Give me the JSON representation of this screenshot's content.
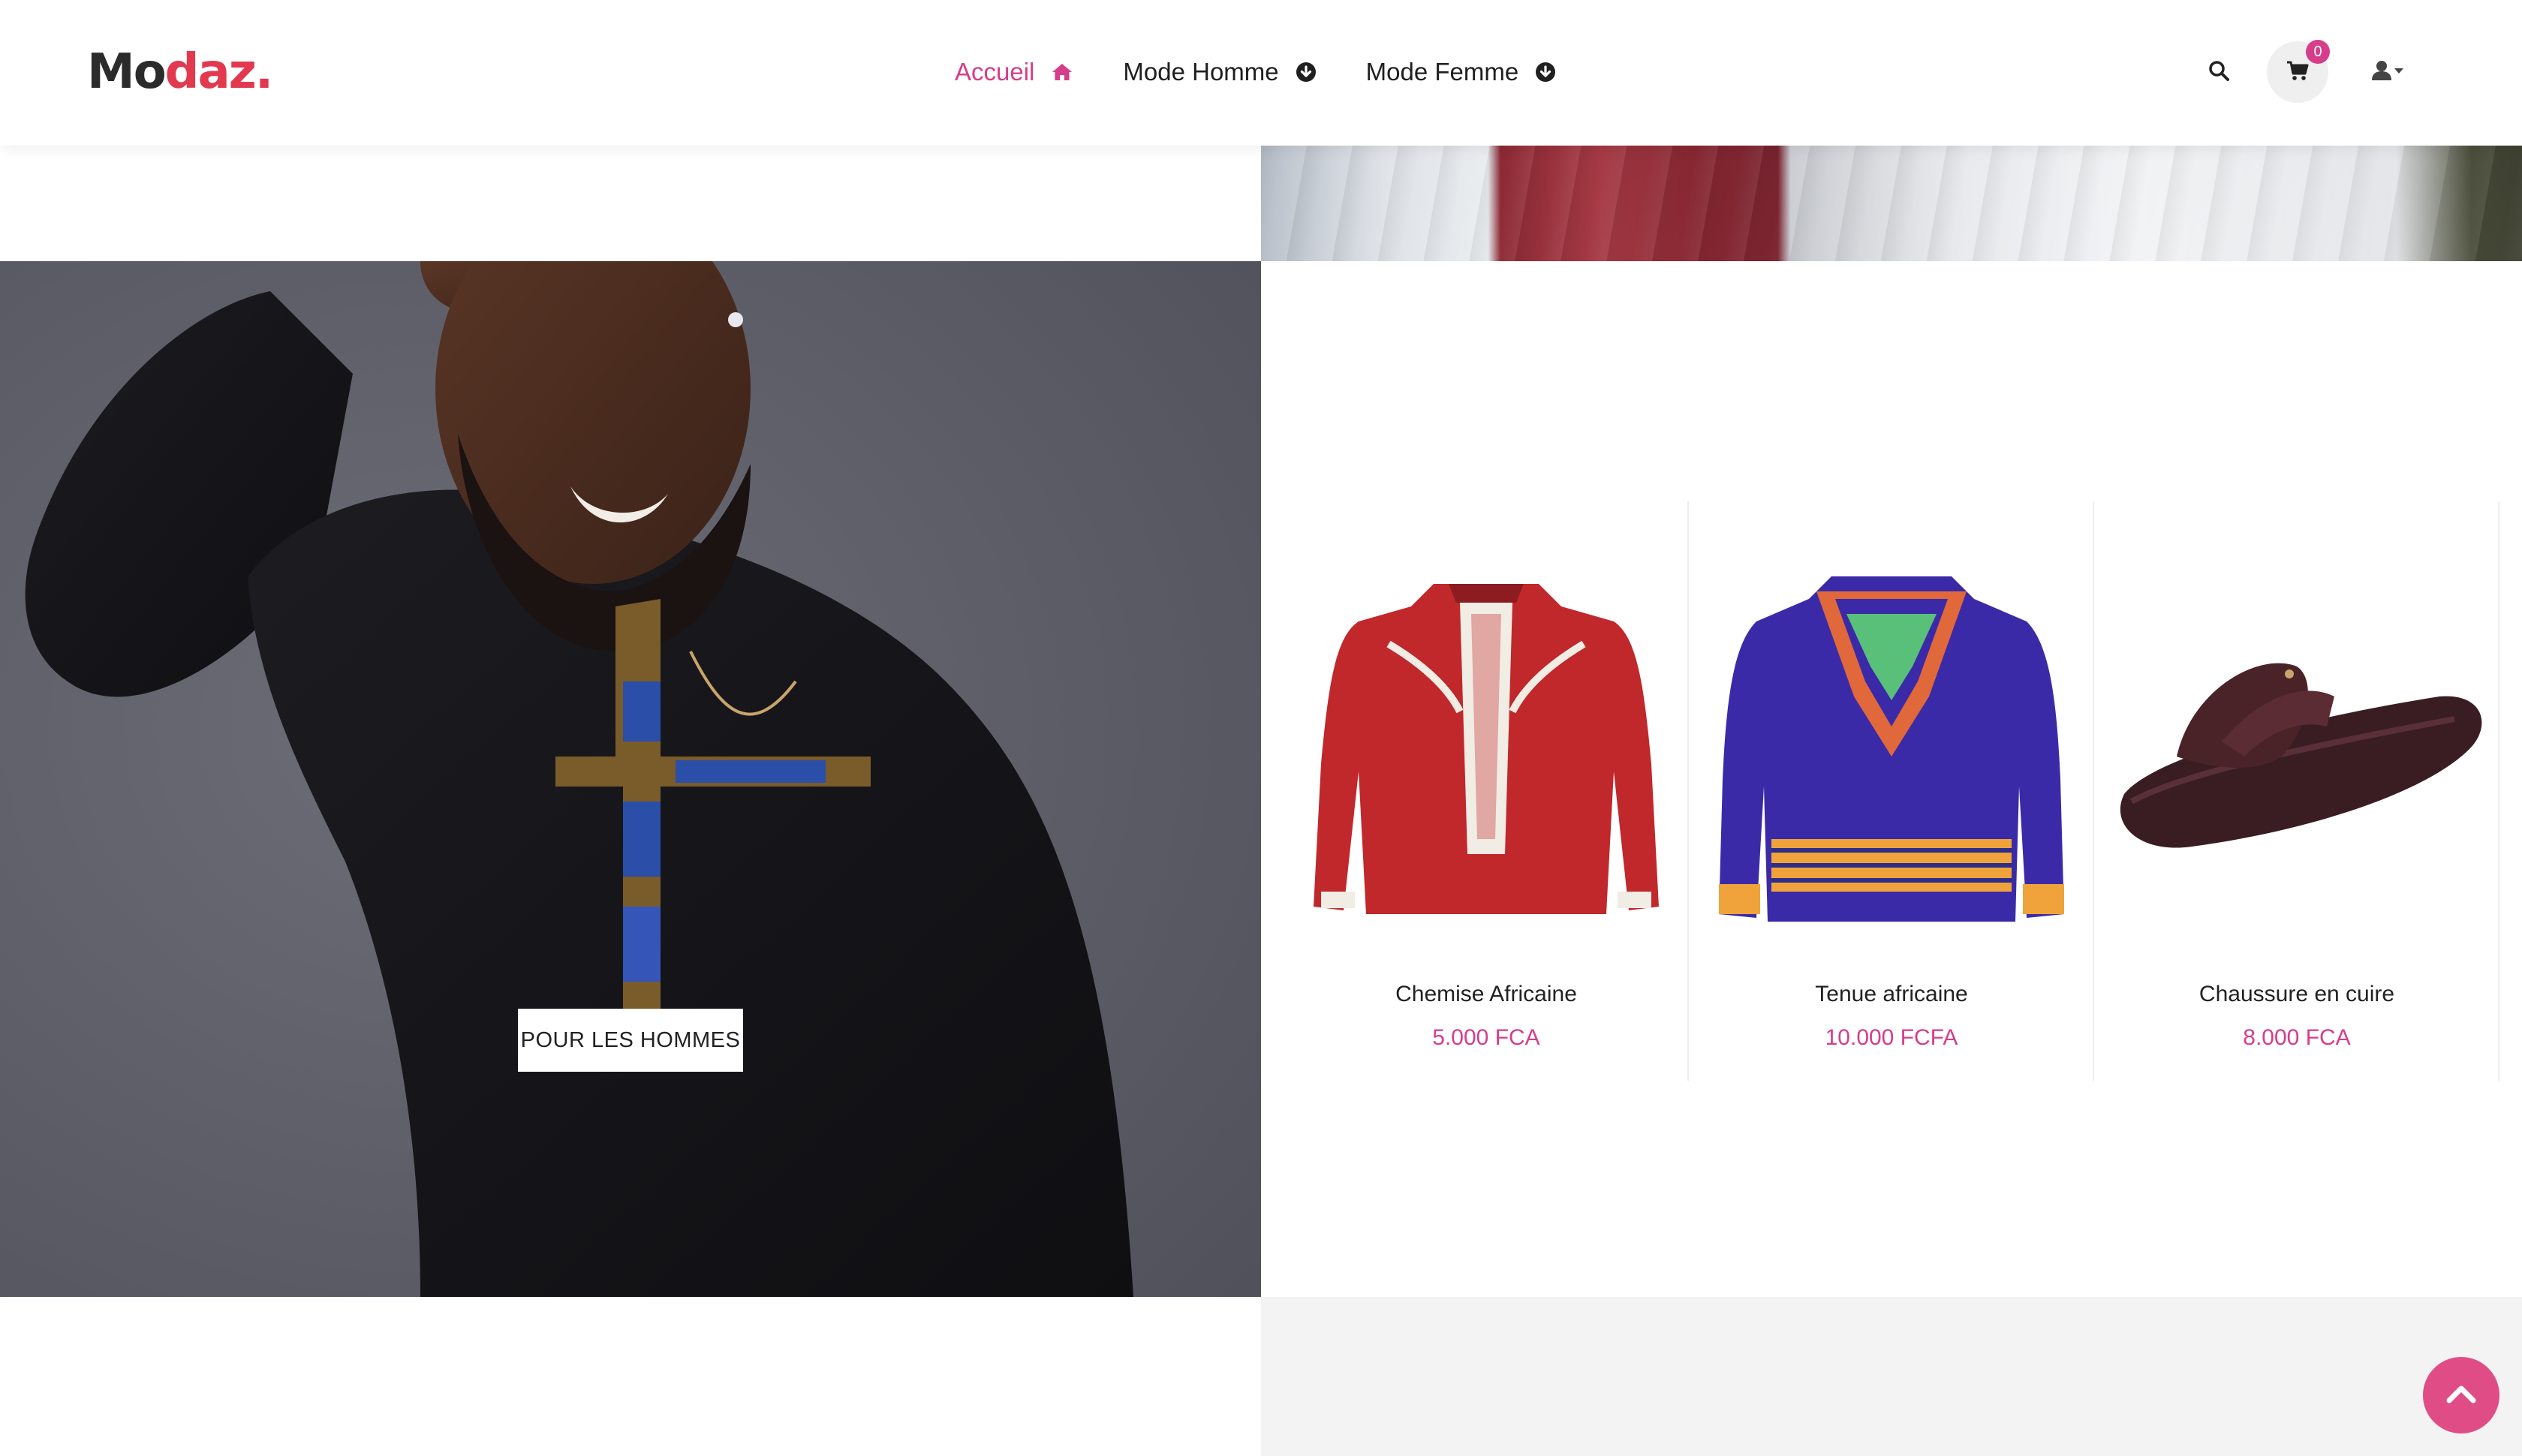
{
  "brand": {
    "part1": "Mo",
    "part2": "daz."
  },
  "nav": {
    "items": [
      {
        "label": "Accueil",
        "icon": "home-icon",
        "active": true
      },
      {
        "label": "Mode Homme",
        "icon": "arrow-circle-down-icon",
        "active": false
      },
      {
        "label": "Mode Femme",
        "icon": "arrow-circle-down-icon",
        "active": false
      }
    ]
  },
  "header_actions": {
    "search_icon": "search-icon",
    "cart_icon": "cart-icon",
    "cart_count": "0",
    "user_icon": "user-dropdown-icon"
  },
  "banner": {
    "cta_label": "POUR LES HOMMES"
  },
  "products": [
    {
      "name": "Chemise Africaine",
      "price": "5.000 FCA"
    },
    {
      "name": "Tenue africaine",
      "price": "10.000 FCFA"
    },
    {
      "name": "Chaussure en cuire",
      "price": "8.000 FCA"
    }
  ],
  "colors": {
    "accent": "#d63d8a",
    "logo_dot": "#e2394f",
    "scroll_button": "#e04d86",
    "text": "#1f1f1f"
  }
}
